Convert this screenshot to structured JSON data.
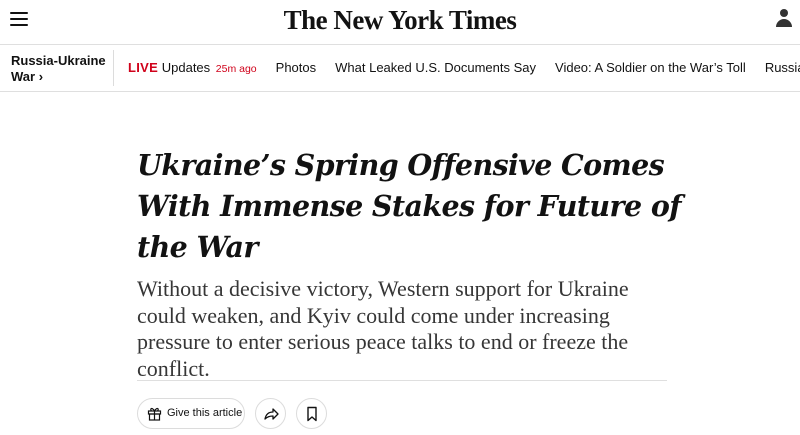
{
  "header": {
    "logo_text": "The New York Times",
    "menu_icon": "hamburger-menu-icon",
    "account_icon": "account-user-icon"
  },
  "subnav": {
    "section_line1": "Russia-Ukraine",
    "section_line2": "War ›",
    "live_label": "LIVE",
    "live_text": "Updates",
    "live_time": "25m ago",
    "items": [
      "Photos",
      "What Leaked U.S. Documents Say",
      "Video: A Soldier on the War’s Toll",
      "Russia’s Faltering C"
    ]
  },
  "article": {
    "headline": "Ukraine’s Spring Offensive Comes With Immense Stakes for Future of the War",
    "summary": "Without a decisive victory, Western support for Ukraine could weaken, and Kyiv could come under increasing pressure to enter serious peace talks to end or freeze the conflict."
  },
  "tools": {
    "gift_label": "Give this article",
    "gift_icon": "gift-icon",
    "share_icon": "share-arrow-icon",
    "save_icon": "bookmark-icon"
  },
  "colors": {
    "live_red": "#d0021b",
    "text": "#121212",
    "summary_text": "#363636",
    "rule": "#dfdfdf"
  }
}
